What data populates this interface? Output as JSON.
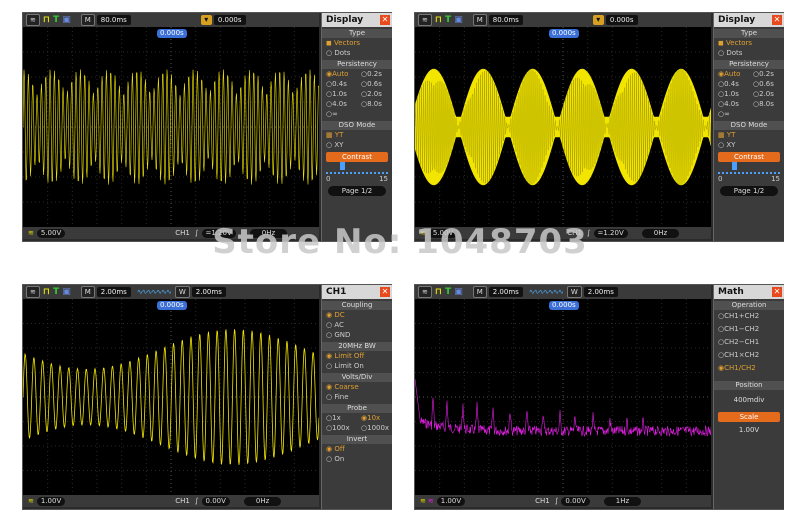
{
  "watermark": "Store No: 1048703",
  "panels": [
    {
      "top": {
        "time_label": "M",
        "time": "80.0ms",
        "trig_delay": "0.000s"
      },
      "marker": "0.000s",
      "bottom": {
        "ch_volts": "5.00V",
        "ch1": "CH1",
        "trig_level": "=1.20V",
        "freq": "0Hz"
      },
      "menu": {
        "title": "Display",
        "type_header": "Type",
        "type_opts": [
          "Vectors",
          "Dots"
        ],
        "persist_header": "Persistency",
        "persist_rows": [
          [
            "Auto",
            "0.2s"
          ],
          [
            "0.4s",
            "0.6s"
          ],
          [
            "1.0s",
            "2.0s"
          ],
          [
            "4.0s",
            "8.0s"
          ],
          [
            "∞",
            ""
          ]
        ],
        "dso_header": "DSO Mode",
        "dso_opts": [
          "YT",
          "XY"
        ],
        "contrast": "Contrast",
        "contrast_min": "0",
        "contrast_max": "15",
        "page": "Page 1/2"
      }
    },
    {
      "top": {
        "time_label": "M",
        "time": "80.0ms",
        "trig_delay": "0.000s"
      },
      "marker": "0.000s",
      "bottom": {
        "ch_volts": "5.00V",
        "ch1": "CH1",
        "trig_level": "=1.20V",
        "freq": "0Hz"
      },
      "menu": {
        "title": "Display",
        "type_header": "Type",
        "type_opts": [
          "Vectors",
          "Dots"
        ],
        "persist_header": "Persistency",
        "persist_rows": [
          [
            "Auto",
            "0.2s"
          ],
          [
            "0.4s",
            "0.6s"
          ],
          [
            "1.0s",
            "2.0s"
          ],
          [
            "4.0s",
            "8.0s"
          ],
          [
            "∞",
            ""
          ]
        ],
        "dso_header": "DSO Mode",
        "dso_opts": [
          "YT",
          "XY"
        ],
        "contrast": "Contrast",
        "contrast_min": "0",
        "contrast_max": "15",
        "page": "Page 1/2"
      }
    },
    {
      "top": {
        "time_label": "M",
        "time": "2.00ms",
        "window_label": "W",
        "window": "2.00ms"
      },
      "marker": "0.000s",
      "bottom": {
        "ch_volts": "1.00V",
        "ch1": "CH1",
        "trig_level": "0.00V",
        "freq": "0Hz"
      },
      "menu": {
        "title": "CH1",
        "coupling_header": "Coupling",
        "coupling_opts": [
          "DC",
          "AC",
          "GND"
        ],
        "bw_header": "20MHz BW",
        "bw_opts": [
          "Limit Off",
          "Limit On"
        ],
        "vdiv_header": "Volts/Div",
        "vdiv_opts": [
          "Coarse",
          "Fine"
        ],
        "probe_header": "Probe",
        "probe_rows": [
          [
            "1x",
            "10x"
          ],
          [
            "100x",
            "1000x"
          ]
        ],
        "invert_header": "Invert",
        "invert_opts": [
          "Off",
          "On"
        ]
      }
    },
    {
      "top": {
        "time_label": "M",
        "time": "2.00ms",
        "window_label": "W",
        "window": "2.00ms"
      },
      "marker": "0.000s",
      "bottom": {
        "ch_volts": "1.00V",
        "ch1": "CH1",
        "trig_level": "0.00V",
        "freq": "1Hz"
      },
      "menu": {
        "title": "Math",
        "op_header": "Operation",
        "op_opts": [
          "CH1+CH2",
          "CH1−CH2",
          "CH2−CH1",
          "CH1×CH2",
          "CH1/CH2"
        ],
        "pos_header": "Position",
        "pos_value": "400mdiv",
        "scale_header": "Scale",
        "scale_value": "1.00V"
      }
    }
  ],
  "colors": {
    "trace_yellow": "#f2e600",
    "trace_magenta": "#e020e0",
    "highlight": "#e46a1c",
    "marker_blue": "#3a6fd8"
  }
}
